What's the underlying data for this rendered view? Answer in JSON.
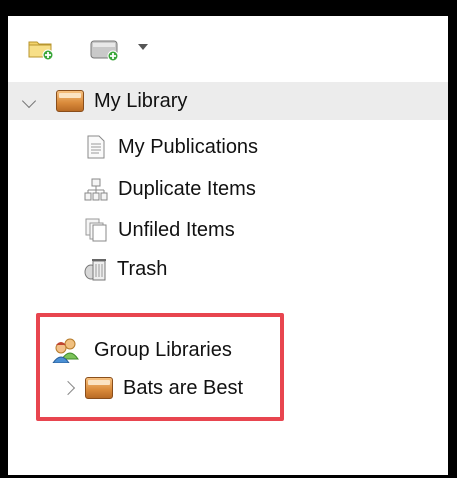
{
  "toolbar": {
    "new_collection_icon": "new-collection-icon",
    "new_library_icon": "new-library-icon",
    "dropdown_icon": "chevron-down-icon"
  },
  "tree": {
    "my_library": {
      "label": "My Library",
      "expanded": true
    },
    "children": [
      {
        "label": "My Publications",
        "icon": "document-icon"
      },
      {
        "label": "Duplicate Items",
        "icon": "duplicate-items-icon"
      },
      {
        "label": "Unfiled Items",
        "icon": "unfiled-items-icon"
      },
      {
        "label": "Trash",
        "icon": "trash-icon"
      }
    ],
    "group_libraries": {
      "label": "Group Libraries",
      "icon": "group-icon"
    },
    "groups": [
      {
        "label": "Bats are Best",
        "expanded": false,
        "icon": "library-icon"
      }
    ]
  },
  "colors": {
    "highlight": "#e8454f",
    "selected_row": "#ececec",
    "frame": "#000000"
  }
}
